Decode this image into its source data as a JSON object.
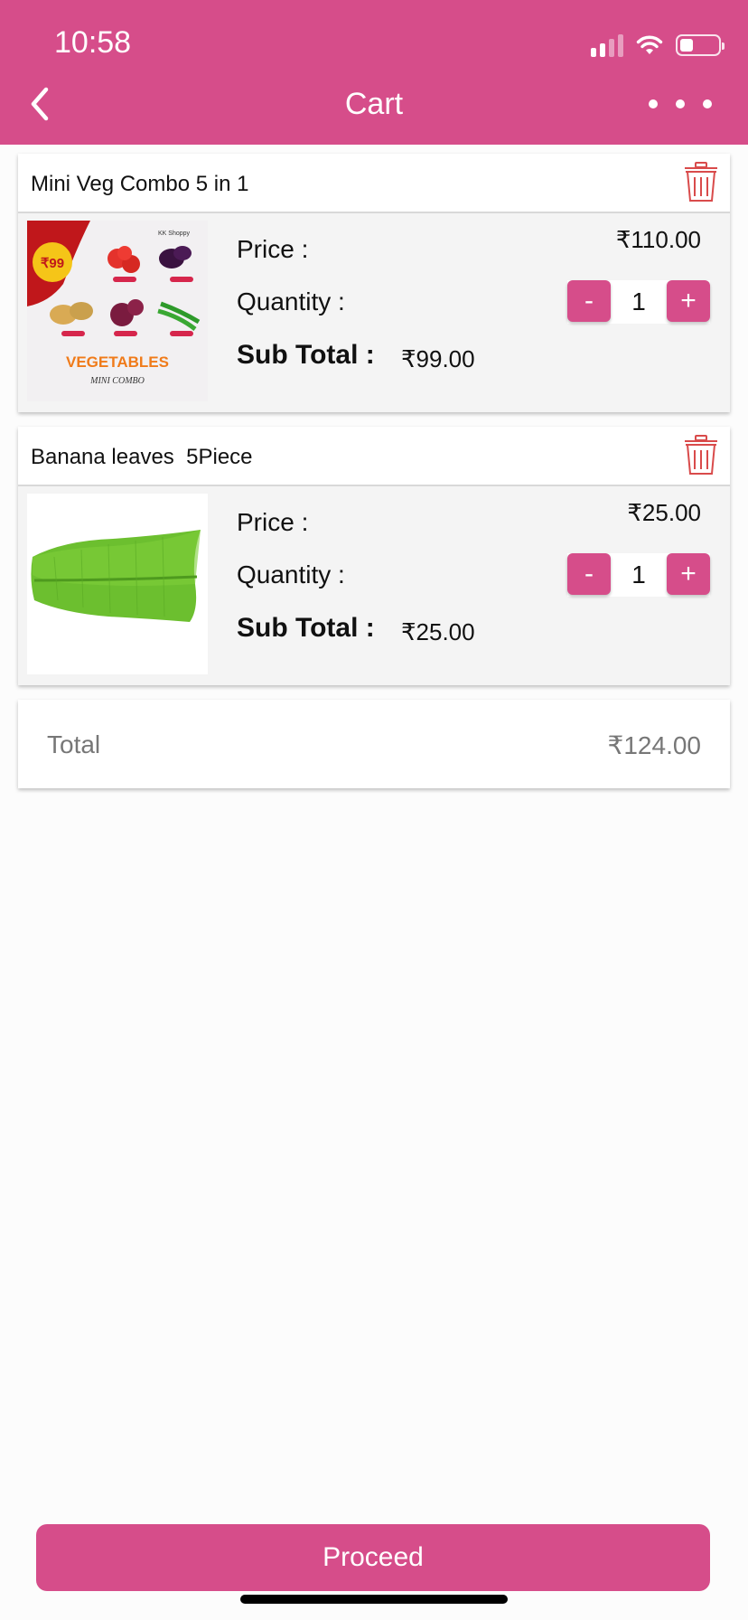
{
  "status_bar": {
    "time": "10:58"
  },
  "header": {
    "title": "Cart",
    "back_icon": "chevron-left-icon",
    "more_icon": "more-horizontal-icon"
  },
  "colors": {
    "accent": "#d64d8a",
    "delete": "#d94b4b"
  },
  "items": [
    {
      "name": "Mini Veg Combo 5 in 1",
      "price_label": "Price :",
      "price": "₹110.00",
      "quantity_label": "Quantity :",
      "minus": "-",
      "quantity": "1",
      "plus": "+",
      "subtotal_label": "Sub Total :",
      "subtotal": "₹99.00",
      "image_texts": {
        "badge": "₹99",
        "brand": "KK Shoppy",
        "title": "VEGETABLES",
        "subtitle": "MINI COMBO"
      }
    },
    {
      "name": "Banana leaves  5Piece",
      "price_label": "Price :",
      "price": "₹25.00",
      "quantity_label": "Quantity :",
      "minus": "-",
      "quantity": "1",
      "plus": "+",
      "subtotal_label": "Sub Total :",
      "subtotal": "₹25.00"
    }
  ],
  "total": {
    "label": "Total",
    "value": "₹124.00"
  },
  "proceed": {
    "label": "Proceed"
  }
}
